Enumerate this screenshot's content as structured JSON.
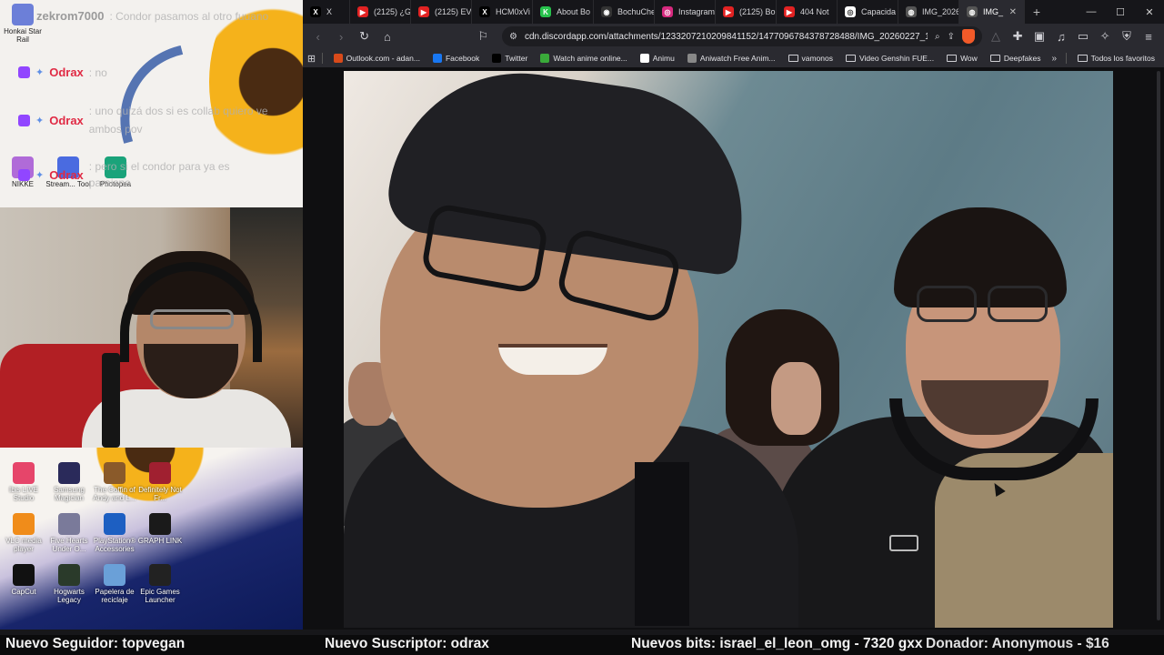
{
  "chat": {
    "lines": [
      {
        "name": "zekrom7000",
        "msg": ": Condor pasamos al otro fuuano"
      },
      {
        "name": "Odrax",
        "msg": ": no"
      },
      {
        "name": "Odrax",
        "msg": ": uno quizá dos si es collab quiero ve ambos pov"
      },
      {
        "name": "Odrax",
        "msg": ": pero si el condor para ya es paraisno"
      }
    ]
  },
  "desktop_top_icons": [
    {
      "label": "Honkai Star Rail",
      "color": "#6c7fd8"
    },
    {
      "label": "NIKKE",
      "color": "#b06bd8"
    },
    {
      "label": "Stream... Tool",
      "color": "#4a6be0"
    },
    {
      "label": "Photopea",
      "color": "#1aa37a"
    }
  ],
  "desktop_bottom_icons": [
    {
      "label": "Ibis LIVE Studio",
      "color": "#e6456a"
    },
    {
      "label": "Samsung Magician",
      "color": "#2a2a5a"
    },
    {
      "label": "The Coffin of Andy and L...",
      "color": "#8a5a2a"
    },
    {
      "label": "Definitely Not Fr...",
      "color": "#a02030"
    },
    {
      "label": "VLC media player",
      "color": "#f08c1a"
    },
    {
      "label": "Five Hearts Under O...",
      "color": "#7a7a9a"
    },
    {
      "label": "PlayStation® Accessories",
      "color": "#1d5fc2"
    },
    {
      "label": "GRAPH LINK",
      "color": "#1a1a1a"
    },
    {
      "label": "CapCut",
      "color": "#111111"
    },
    {
      "label": "Hogwarts Legacy",
      "color": "#2a3a2a"
    },
    {
      "label": "Papelera de reciclaje",
      "color": "#6aa0d8"
    },
    {
      "label": "Epic Games Launcher",
      "color": "#222222"
    }
  ],
  "browser": {
    "tabs": [
      {
        "label": "X",
        "fav": "X",
        "fav_color": "#000000"
      },
      {
        "label": "(2125) ¿G",
        "fav": "▶",
        "fav_color": "#e22222"
      },
      {
        "label": "(2125) EV",
        "fav": "▶",
        "fav_color": "#e22222"
      },
      {
        "label": "HCM0xVi",
        "fav": "X",
        "fav_color": "#000000"
      },
      {
        "label": "About Bo",
        "fav": "K",
        "fav_color": "#27c24c"
      },
      {
        "label": "BochuChe",
        "fav": "◉",
        "fav_color": "#333333"
      },
      {
        "label": "Instagram",
        "fav": "◎",
        "fav_color": "#d6297e"
      },
      {
        "label": "(2125) Bo",
        "fav": "▶",
        "fav_color": "#e22222"
      },
      {
        "label": "404 Not",
        "fav": "▶",
        "fav_color": "#e22222"
      },
      {
        "label": "Capacida",
        "fav": "◎",
        "fav_color": "#ffffff"
      },
      {
        "label": "IMG_2026",
        "fav": "◍",
        "fav_color": "#555555"
      },
      {
        "label": "IMG_",
        "fav": "◍",
        "fav_color": "#555555"
      }
    ],
    "url": "cdn.discordapp.com/attachments/1233207210209841152/1477096784378728488/IMG_20260227_18...",
    "bookmarks": [
      {
        "label": "Outlook.com - adan...",
        "kind": "icon",
        "color": "#d84a1a"
      },
      {
        "label": "Facebook",
        "kind": "icon",
        "color": "#1877f2"
      },
      {
        "label": "Twitter",
        "kind": "icon",
        "color": "#000000"
      },
      {
        "label": "Watch anime online...",
        "kind": "icon",
        "color": "#3aaa3a"
      },
      {
        "label": "Animu",
        "kind": "icon",
        "color": "#ffffff"
      },
      {
        "label": "Aniwatch Free Anim...",
        "kind": "icon",
        "color": "#888888"
      },
      {
        "label": "vamonos",
        "kind": "folder"
      },
      {
        "label": "Video Genshin FUE...",
        "kind": "folder"
      },
      {
        "label": "Wow",
        "kind": "folder"
      },
      {
        "label": "Deepfakes",
        "kind": "folder"
      }
    ],
    "all_bookmarks": "Todos los favoritos"
  },
  "ticker": {
    "follower": "Nuevo Seguidor: topvegan",
    "subscriber": "Nuevo Suscriptor: odrax",
    "bits": "Nuevos bits: israel_el_leon_omg - 7320 gxx",
    "donor": "Donador: Anonymous - $16"
  }
}
